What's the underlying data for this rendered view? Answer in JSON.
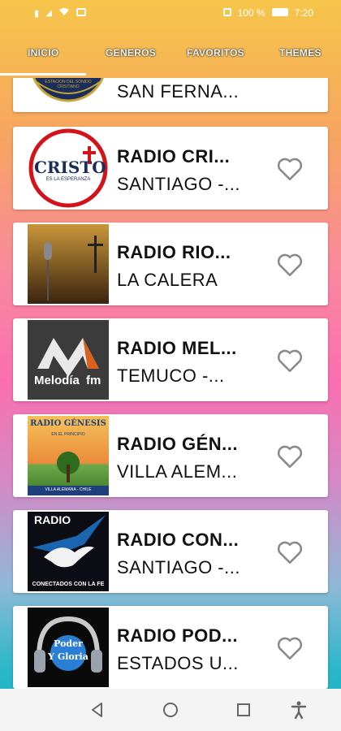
{
  "status_bar": {
    "battery": "100 %",
    "time": "7:20",
    "icons": [
      "sim-icon",
      "signal-icon",
      "wifi-icon",
      "message-icon",
      "vibrate-icon",
      "battery-icon"
    ]
  },
  "tabs": [
    {
      "label": "INICIO",
      "selected": true
    },
    {
      "label": "GENEROS",
      "selected": false
    },
    {
      "label": "FAVORITOS",
      "selected": false
    },
    {
      "label": "THEMES",
      "selected": false
    }
  ],
  "stations": [
    {
      "title": "SAN FERNA...",
      "subtitle": "",
      "logo_text": "ESTACION DEL SONIDO CRISTIANO"
    },
    {
      "title": "RADIO CRI...",
      "subtitle": "SANTIAGO -...",
      "logo_text": "CRISTO",
      "logo_subtext": "ES LA ESPERANZA"
    },
    {
      "title": "RADIO RIO...",
      "subtitle": "LA CALERA",
      "logo_text": ""
    },
    {
      "title": "RADIO MEL...",
      "subtitle": "TEMUCO -...",
      "logo_text": "Melodía",
      "logo_subtext": "fm"
    },
    {
      "title": "RADIO GÉN...",
      "subtitle": "VILLA ALEM...",
      "logo_text": "RADIO GÉNESIS",
      "logo_subtext": "EN EL PRINCIPIO",
      "logo_footer": "VILLA ALEMANA - CHILE"
    },
    {
      "title": "RADIO CON...",
      "subtitle": "SANTIAGO -...",
      "logo_text": "RADIO",
      "logo_subtext": "CONECTADOS CON LA FE"
    },
    {
      "title": "RADIO POD...",
      "subtitle": "ESTADOS U...",
      "logo_text": "Poder",
      "logo_subtext": "Y Gloria"
    }
  ],
  "colors": {
    "gradient_top": "#f6c64a",
    "gradient_mid": "#fb6fb0",
    "gradient_bottom": "#1fb3c6",
    "card": "#ffffff",
    "heart_stroke": "#8a8a8a"
  },
  "nav_bar": [
    "back-icon",
    "home-icon",
    "recents-icon",
    "accessibility-icon"
  ]
}
